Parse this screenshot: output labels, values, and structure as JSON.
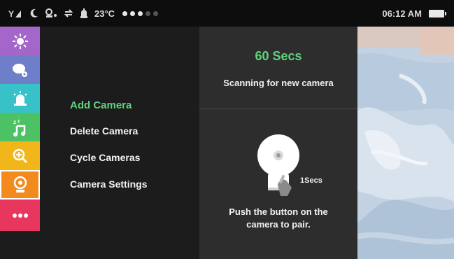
{
  "status_bar": {
    "temperature": "23°C",
    "time": "06:12 AM",
    "page_dots": [
      "on",
      "on",
      "on",
      "off",
      "off"
    ]
  },
  "rail": {
    "items": [
      {
        "icon": "nightlight-icon",
        "color": "#a466c8"
      },
      {
        "icon": "lullaby-icon",
        "color": "#6f7ec9"
      },
      {
        "icon": "alarm-icon",
        "color": "#37c2c9"
      },
      {
        "icon": "sleep-music-icon",
        "color": "#4cc264"
      },
      {
        "icon": "zoom-in-icon",
        "color": "#f1b61a"
      },
      {
        "icon": "camera-icon",
        "color": "#f28a1e",
        "selected": true
      },
      {
        "icon": "more-icon",
        "color": "#e8365f"
      }
    ]
  },
  "menu": {
    "items": [
      {
        "label": "Add Camera",
        "active": true
      },
      {
        "label": "Delete Camera",
        "active": false
      },
      {
        "label": "Cycle Cameras",
        "active": false
      },
      {
        "label": "Camera Settings",
        "active": false
      }
    ]
  },
  "pairing": {
    "countdown": "60 Secs",
    "status": "Scanning for new camera",
    "button_timer": "1Secs",
    "instruction_line1": "Push the button on the",
    "instruction_line2": "camera to pair."
  },
  "colors": {
    "accent_green": "#5fd37b",
    "panel_dark": "#1c1c1c",
    "panel_mid": "#2d2d2d"
  }
}
